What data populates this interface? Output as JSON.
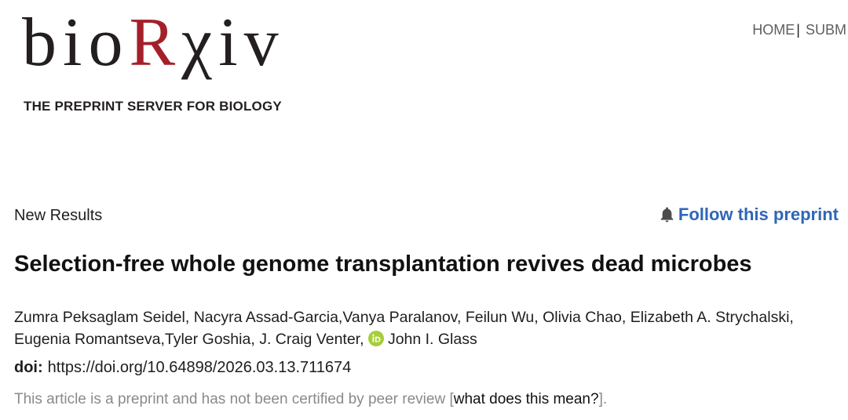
{
  "colors": {
    "text": "#1e1e1e",
    "logo_dark": "#231f20",
    "logo_accent": "#a3202a",
    "link_blue": "#2f66b7",
    "nav_text": "#5f5f5f",
    "notice_text": "#8a8a8a",
    "notice_link": "#111111",
    "orcid_green": "#a6ce39",
    "icon_grey": "#4d4d4d"
  },
  "logo": {
    "prefix": "bio",
    "accent": "R",
    "suffix": "χiv",
    "tagline": "THE PREPRINT SERVER FOR BIOLOGY"
  },
  "nav": {
    "home": "HOME",
    "separator": "|",
    "submit": "SUBM"
  },
  "article": {
    "type_label": "New Results",
    "follow": {
      "icon": "bell-icon",
      "label": "Follow this preprint"
    },
    "title": "Selection-free whole genome transplantation revives dead microbes",
    "authors": [
      {
        "name": "Zumra Peksaglam Seidel",
        "sep": ", "
      },
      {
        "name": "Nacyra Assad-Garcia",
        "sep": ","
      },
      {
        "name": "Vanya Paralanov",
        "sep": ", "
      },
      {
        "name": "Feilun Wu",
        "sep": ", "
      },
      {
        "name": "Olivia Chao",
        "sep": ", "
      },
      {
        "name": "Elizabeth A. Strychalski",
        "sep": ","
      },
      {
        "name": "Eugenia Romantseva",
        "sep": ","
      },
      {
        "name": "Tyler Goshia",
        "sep": ", "
      },
      {
        "name": "J. Craig Venter",
        "sep": ", "
      },
      {
        "name": "John I. Glass",
        "orcid_icon": "orcid-icon",
        "orcid_lettering": "iD"
      }
    ],
    "doi": {
      "label": "doi:",
      "url": "https://doi.org/10.64898/2026.03.13.711674"
    },
    "notice": {
      "text": "This article is a preprint and has not been certified by peer review [",
      "link": "what does this mean?",
      "close": "]."
    }
  }
}
